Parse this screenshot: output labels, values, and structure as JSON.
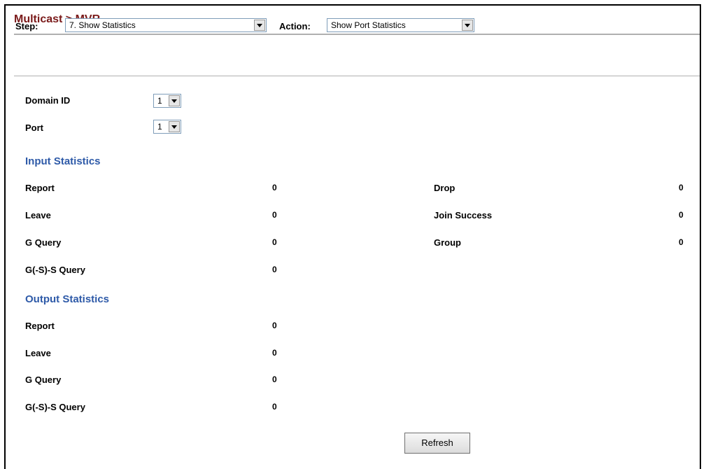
{
  "header": {
    "title": "Multicast > MVR"
  },
  "toolbar": {
    "step_label": "Step:",
    "step_value": "7. Show Statistics",
    "action_label": "Action:",
    "action_value": "Show Port Statistics"
  },
  "form": {
    "domain_label": "Domain ID",
    "domain_value": "1",
    "port_label": "Port",
    "port_value": "1"
  },
  "input_statistics": {
    "title": "Input Statistics",
    "left": [
      {
        "label": "Report",
        "value": "0"
      },
      {
        "label": "Leave",
        "value": "0"
      },
      {
        "label": "G Query",
        "value": "0"
      },
      {
        "label": "G(-S)-S Query",
        "value": "0"
      }
    ],
    "right": [
      {
        "label": "Drop",
        "value": "0"
      },
      {
        "label": "Join Success",
        "value": "0"
      },
      {
        "label": "Group",
        "value": "0"
      }
    ]
  },
  "output_statistics": {
    "title": "Output Statistics",
    "rows": [
      {
        "label": "Report",
        "value": "0"
      },
      {
        "label": "Leave",
        "value": "0"
      },
      {
        "label": "G Query",
        "value": "0"
      },
      {
        "label": "G(-S)-S Query",
        "value": "0"
      }
    ]
  },
  "buttons": {
    "refresh_label": "Refresh"
  }
}
